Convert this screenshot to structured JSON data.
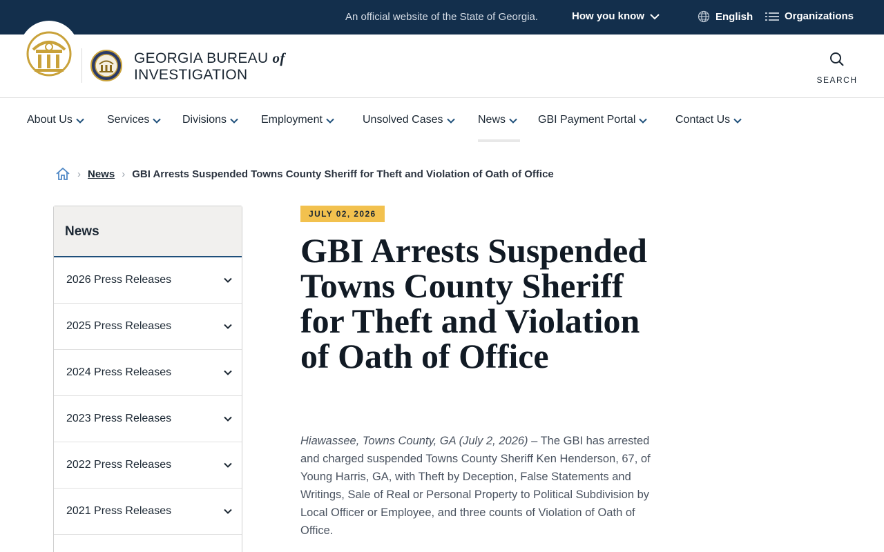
{
  "topbar": {
    "official_text": "An official website of the State of Georgia.",
    "how_you_know": "How you know",
    "language": "English",
    "organizations": "Organizations"
  },
  "header": {
    "brand_line1_pre": "GEORGIA BUREAU ",
    "brand_line1_of": "of",
    "brand_line2": "INVESTIGATION",
    "search_label": "SEARCH"
  },
  "nav": {
    "items": [
      {
        "label": "About Us"
      },
      {
        "label": "Services"
      },
      {
        "label": "Divisions"
      },
      {
        "label": "Employment"
      },
      {
        "label": "Unsolved Cases"
      },
      {
        "label": "News"
      },
      {
        "label": "GBI Payment Portal"
      },
      {
        "label": "Contact Us"
      }
    ]
  },
  "breadcrumb": {
    "link": "News",
    "current": "GBI Arrests Suspended Towns County Sheriff for Theft and Violation of Oath of Office"
  },
  "sidebar": {
    "title": "News",
    "items": [
      {
        "label": "2026 Press Releases"
      },
      {
        "label": "2025 Press Releases"
      },
      {
        "label": "2024 Press Releases"
      },
      {
        "label": "2023 Press Releases"
      },
      {
        "label": "2022 Press Releases"
      },
      {
        "label": "2021 Press Releases"
      }
    ]
  },
  "article": {
    "date": "JULY 02, 2026",
    "headline": "GBI Arrests Suspended Towns County Sheriff for Theft and Violation of Oath of Office",
    "dateline": "Hiawassee, Towns County, GA (July 2, 2026)",
    "body": " – The GBI has arrested and charged suspended Towns County Sheriff Ken Henderson, 67, of Young Harris, GA, with Theft by Deception, False Statements and Writings, Sale of Real or Personal Property to Political Subdivision by Local Officer or Employee, and three counts of Violation of Oath of Office."
  },
  "colors": {
    "topbar_bg": "#132f4c",
    "accent_gold": "#f2c14e",
    "sidebar_rule": "#1e4f7a"
  }
}
